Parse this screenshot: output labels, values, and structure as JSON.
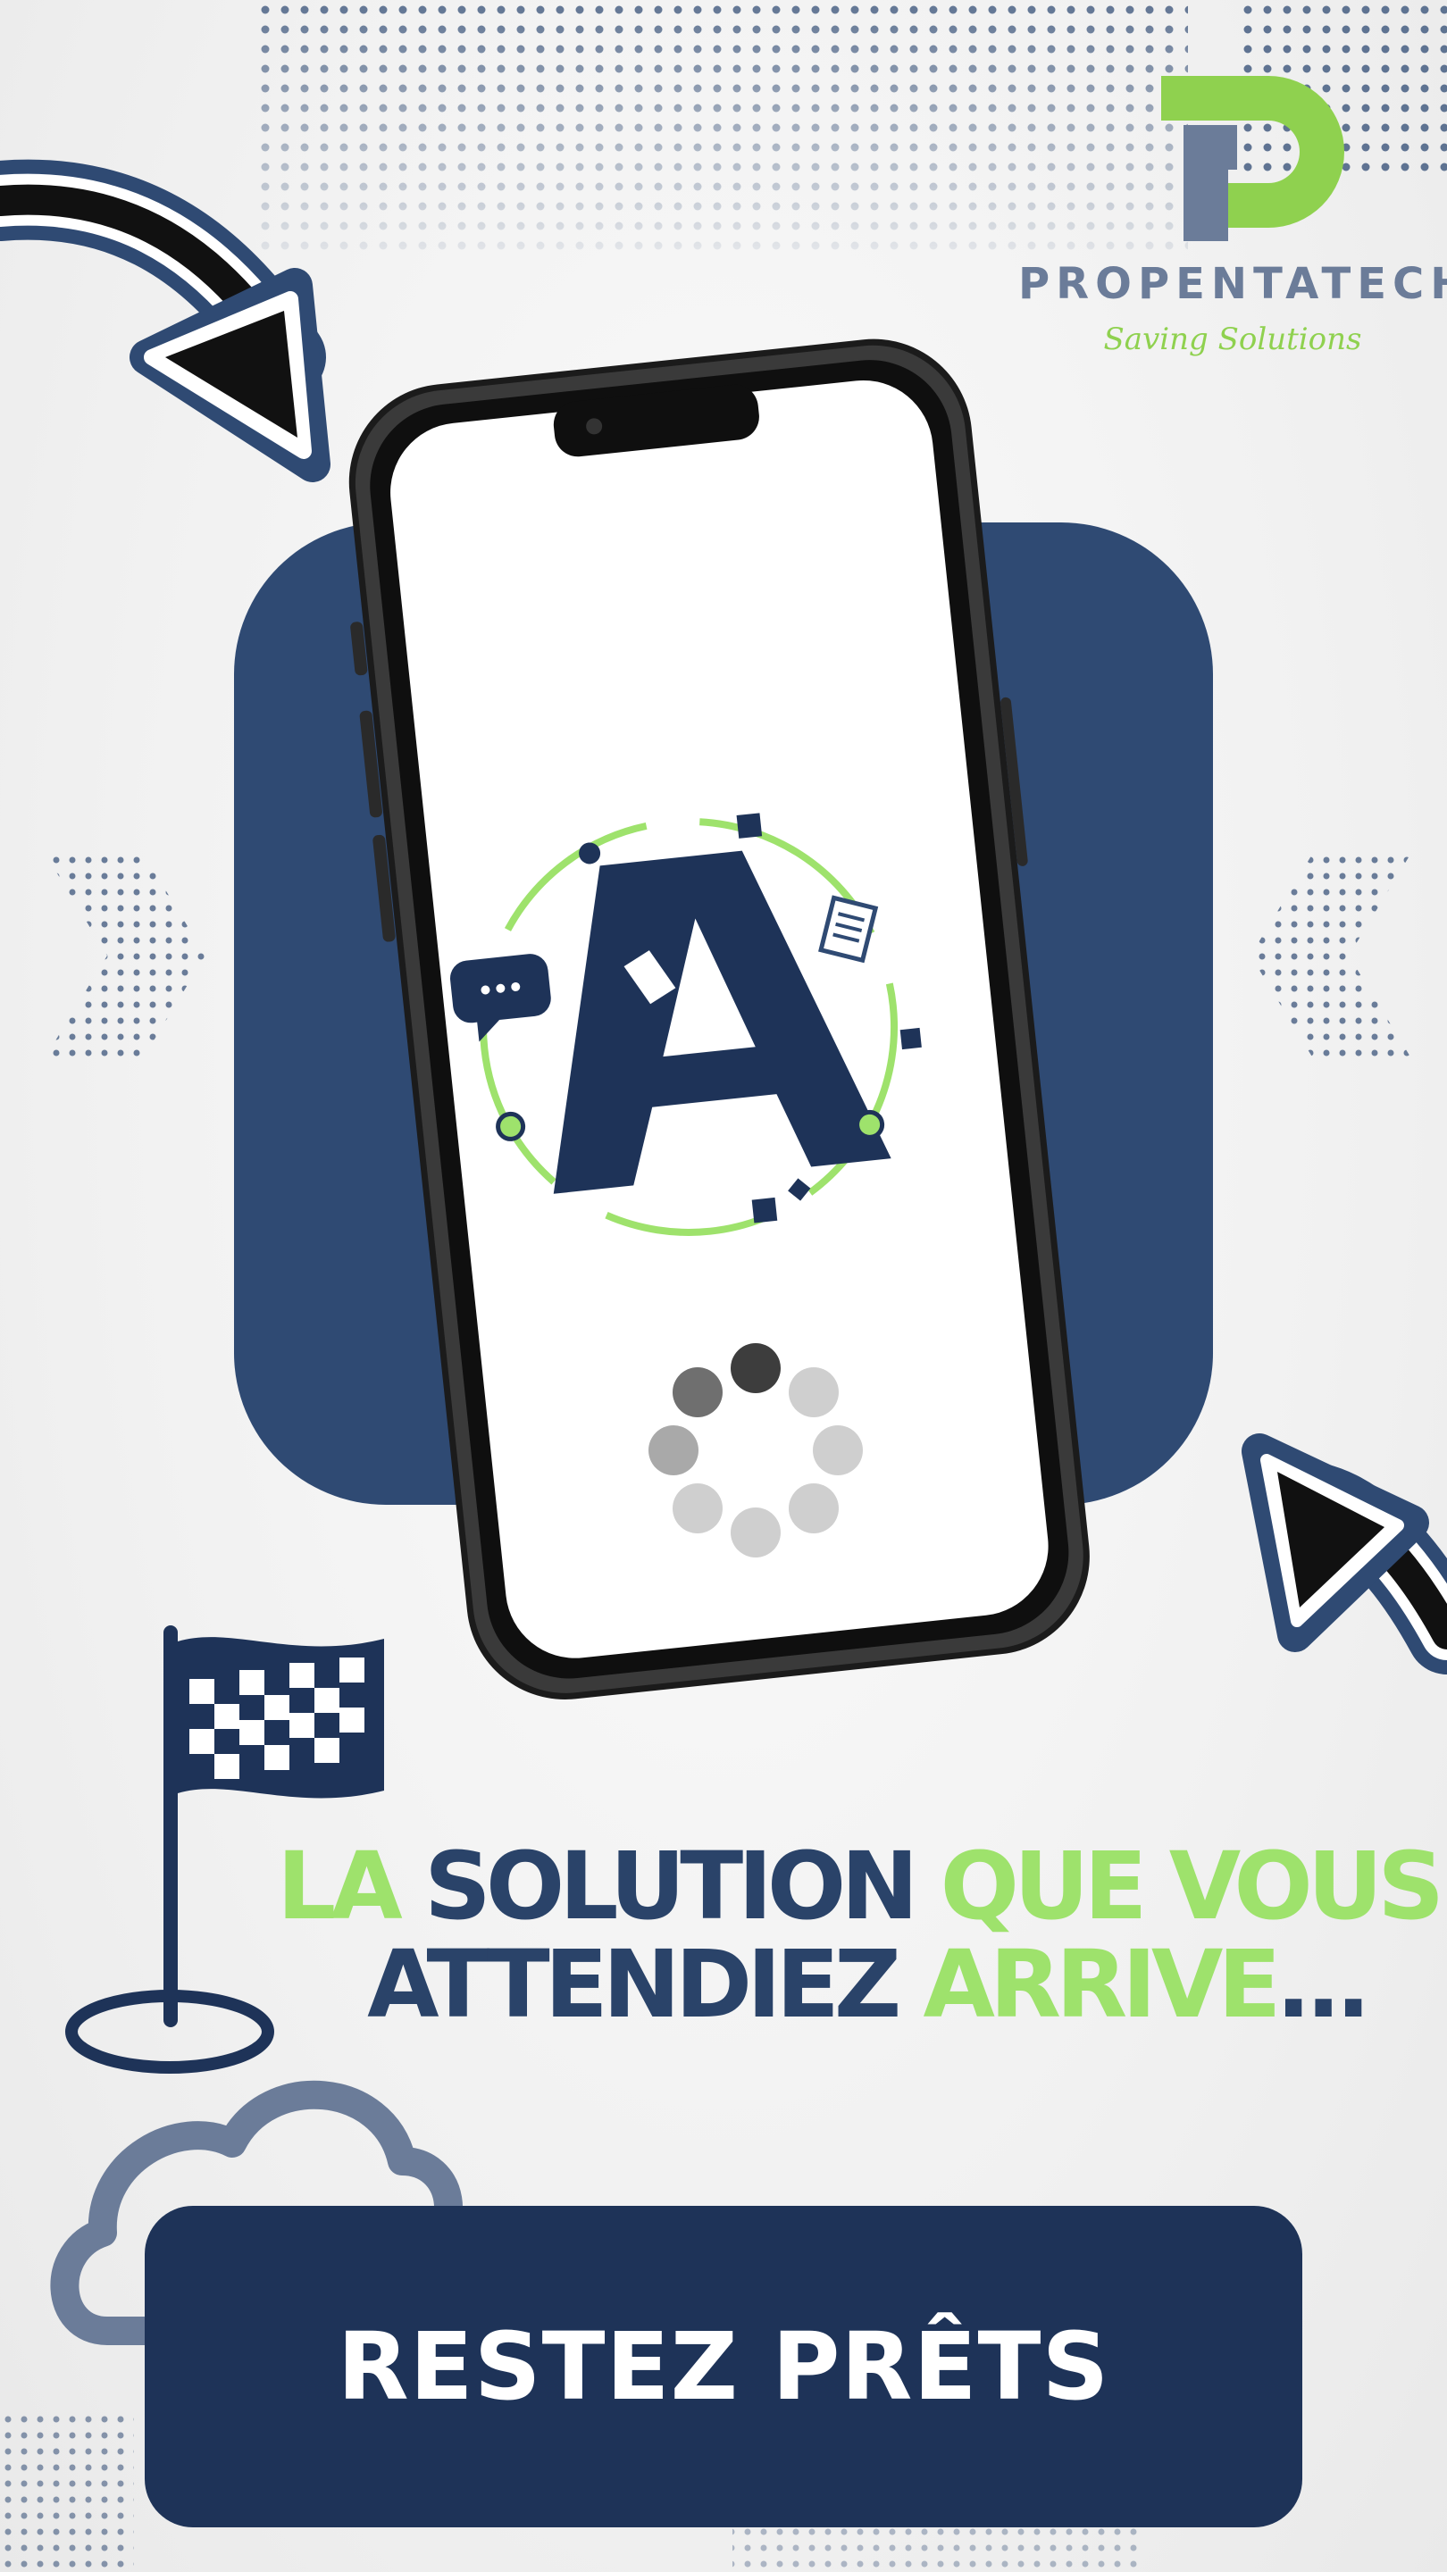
{
  "brand": {
    "name": "PROPENTATECH",
    "tagline": "Saving Solutions"
  },
  "headline": {
    "line1": [
      "LA ",
      "SOLUTION ",
      "QUE VOUS"
    ],
    "line2": [
      "ATTENDIEZ ",
      "ARRIVE",
      "..."
    ]
  },
  "cta": {
    "label": "RESTEZ PRÊTS"
  },
  "colors": {
    "navy": "#1e3358",
    "accent_green": "#9ee26c",
    "panel_blue": "#2f4a73",
    "muted_blue": "#6b7c99"
  },
  "icons": [
    "logo-p-icon",
    "arrow-icon",
    "phone-icon",
    "app-a-logo-icon",
    "chat-bubble-icon",
    "document-icon",
    "loading-spinner-icon",
    "checkered-flag-icon",
    "cloud-icon"
  ]
}
